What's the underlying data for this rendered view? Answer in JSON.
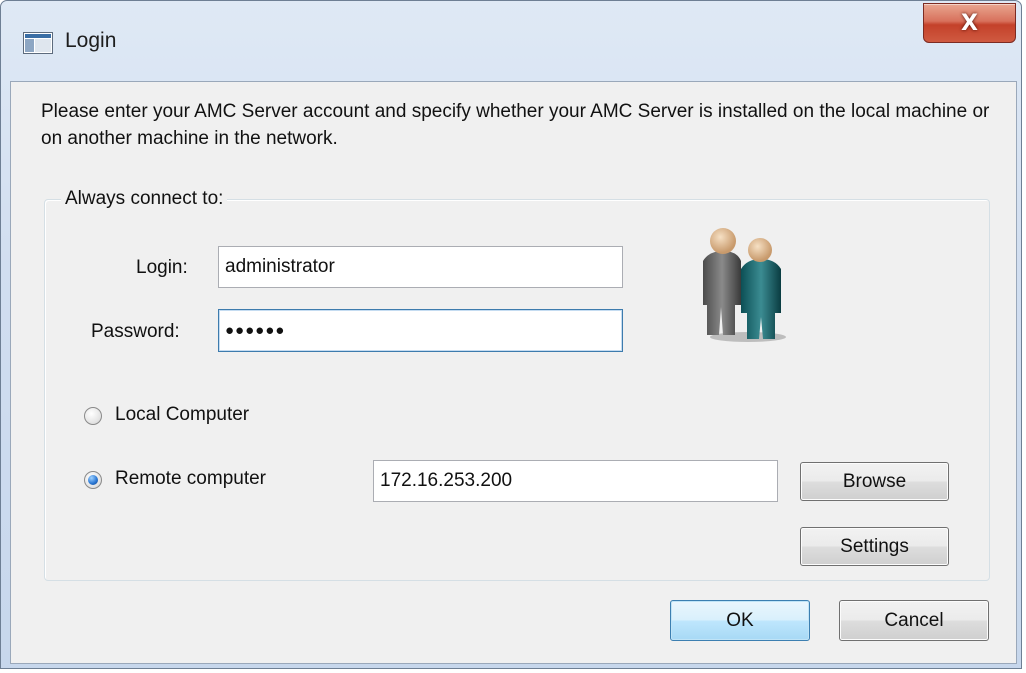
{
  "window": {
    "title": "Login",
    "close_label": "X"
  },
  "instructions": "Please enter your AMC Server account and specify whether your AMC Server is installed on the local machine or on another machine in the network.",
  "group": {
    "legend": "Always connect to:"
  },
  "form": {
    "login_label": "Login:",
    "login_value": "administrator",
    "password_label": "Password:",
    "password_mask": "●●●●●●"
  },
  "connection": {
    "local_label": "Local Computer",
    "local_selected": false,
    "remote_label": "Remote computer",
    "remote_selected": true,
    "remote_address": "172.16.253.200",
    "browse_label": "Browse",
    "settings_label": "Settings"
  },
  "footer": {
    "ok_label": "OK",
    "cancel_label": "Cancel"
  },
  "icons": {
    "app": "window-app-icon",
    "users": "users-icon"
  }
}
